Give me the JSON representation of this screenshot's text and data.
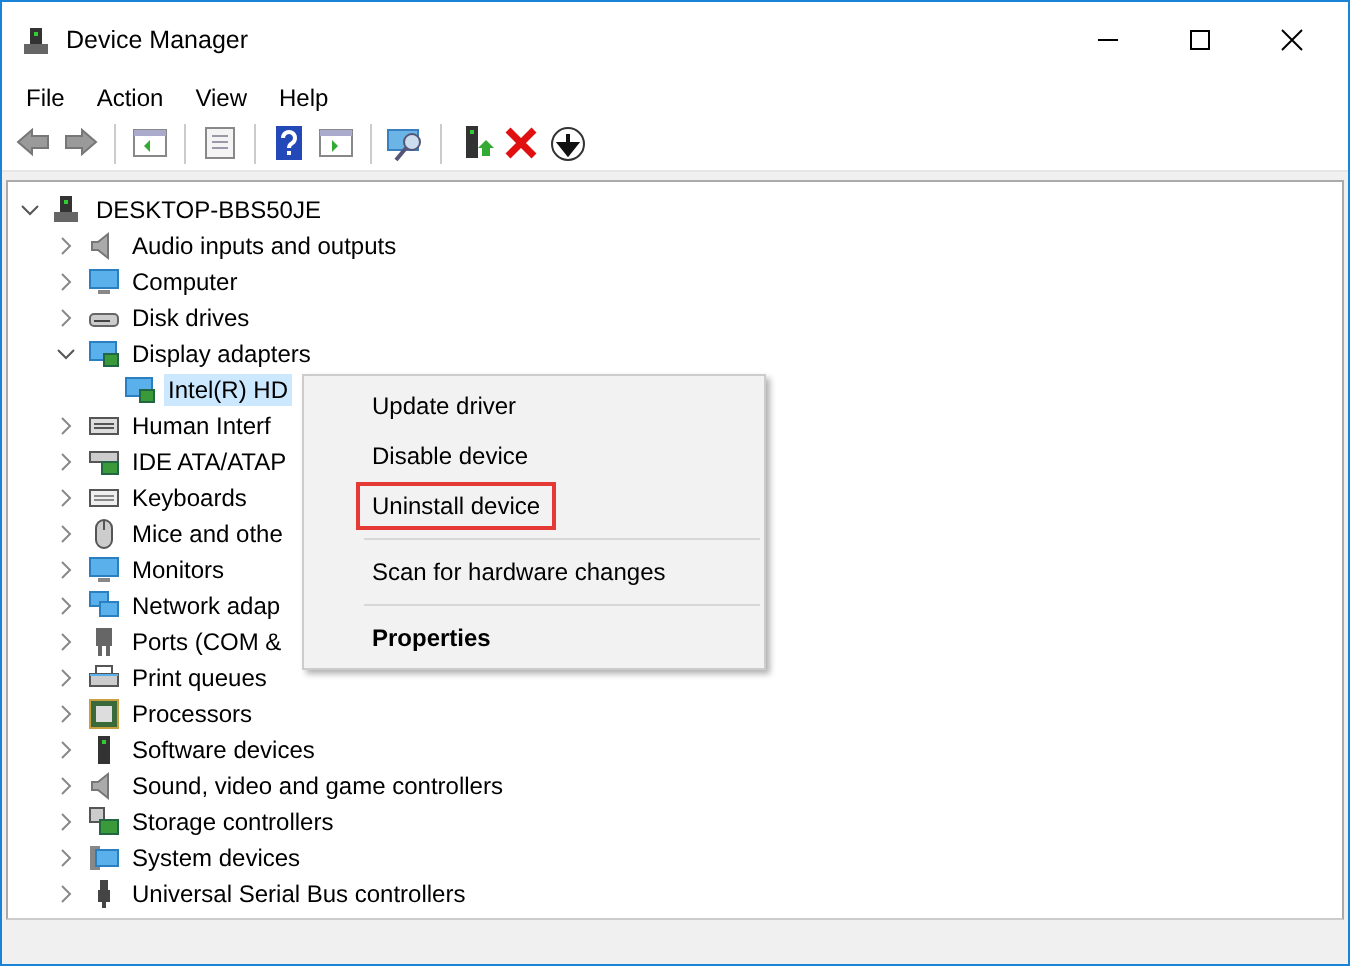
{
  "window": {
    "title": "Device Manager"
  },
  "menu_bar": [
    "File",
    "Action",
    "View",
    "Help"
  ],
  "tree": {
    "label": "DESKTOP-BBS50JE",
    "expanded": true,
    "children": [
      {
        "label": "Audio inputs and outputs",
        "expanded": false
      },
      {
        "label": "Computer",
        "expanded": false
      },
      {
        "label": "Disk drives",
        "expanded": false
      },
      {
        "label": "Display adapters",
        "expanded": true,
        "children": [
          {
            "label": "Intel(R) HD",
            "selected": true
          }
        ]
      },
      {
        "label": "Human Interf",
        "expanded": false
      },
      {
        "label": "IDE ATA/ATAP",
        "expanded": false
      },
      {
        "label": "Keyboards",
        "expanded": false
      },
      {
        "label": "Mice and othe",
        "expanded": false
      },
      {
        "label": "Monitors",
        "expanded": false
      },
      {
        "label": "Network adap",
        "expanded": false
      },
      {
        "label": "Ports (COM &",
        "expanded": false
      },
      {
        "label": "Print queues",
        "expanded": false
      },
      {
        "label": "Processors",
        "expanded": false
      },
      {
        "label": "Software devices",
        "expanded": false
      },
      {
        "label": "Sound, video and game controllers",
        "expanded": false
      },
      {
        "label": "Storage controllers",
        "expanded": false
      },
      {
        "label": "System devices",
        "expanded": false
      },
      {
        "label": "Universal Serial Bus controllers",
        "expanded": false
      }
    ]
  },
  "context_menu": [
    {
      "kind": "item",
      "label": "Update driver",
      "default": false,
      "highlighted": false
    },
    {
      "kind": "item",
      "label": "Disable device",
      "default": false,
      "highlighted": false
    },
    {
      "kind": "item",
      "label": "Uninstall device",
      "default": false,
      "highlighted": true
    },
    {
      "kind": "separator"
    },
    {
      "kind": "item",
      "label": "Scan for hardware changes",
      "default": false,
      "highlighted": false
    },
    {
      "kind": "separator"
    },
    {
      "kind": "item",
      "label": "Properties",
      "default": true,
      "highlighted": false
    }
  ]
}
